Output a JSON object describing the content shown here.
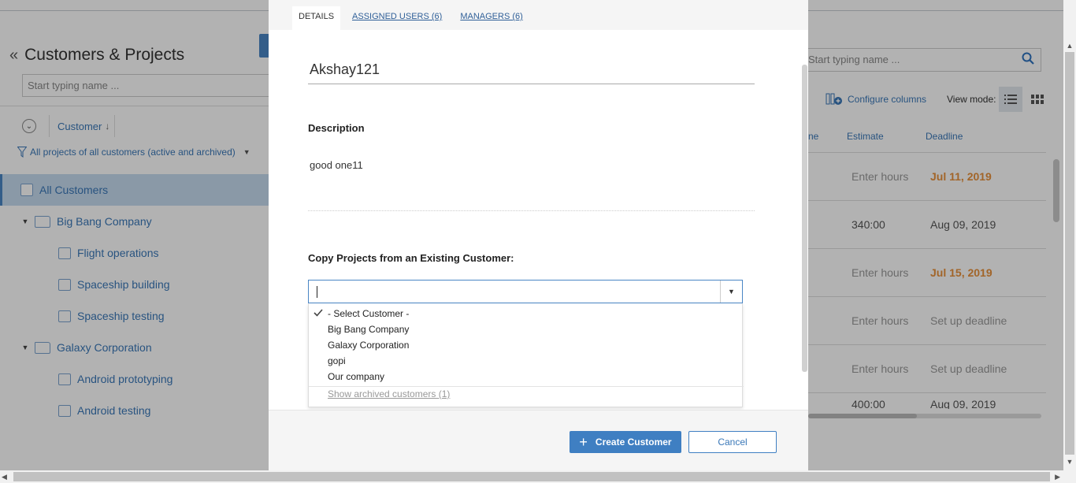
{
  "left": {
    "title": "Customers & Projects",
    "search_placeholder": "Start typing name ...",
    "sort_label": "Customer",
    "filter_label": "All projects of all customers (active and archived)",
    "tree": [
      {
        "label": "All Customers",
        "kind": "all",
        "selected": true
      },
      {
        "label": "Big Bang Company",
        "kind": "customer"
      },
      {
        "label": "Flight operations",
        "kind": "project"
      },
      {
        "label": "Spaceship building",
        "kind": "project"
      },
      {
        "label": "Spaceship testing",
        "kind": "project"
      },
      {
        "label": "Galaxy Corporation",
        "kind": "customer"
      },
      {
        "label": "Android prototyping",
        "kind": "project"
      },
      {
        "label": "Android testing",
        "kind": "project"
      }
    ]
  },
  "right": {
    "search_placeholder": "Start typing name ...",
    "configure_columns": "Configure columns",
    "view_mode_label": "View mode:",
    "columns": {
      "partial": "ne",
      "estimate": "Estimate",
      "deadline": "Deadline"
    },
    "rows": [
      {
        "estimate": "Enter hours",
        "deadline": "Jul 11, 2019"
      },
      {
        "estimate": "340:00",
        "deadline": "Aug 09, 2019"
      },
      {
        "estimate": "Enter hours",
        "deadline": "Jul 15, 2019"
      },
      {
        "estimate": "Enter hours",
        "deadline": "Set up deadline"
      },
      {
        "estimate": "Enter hours",
        "deadline": "Set up deadline"
      },
      {
        "estimate": "400:00",
        "deadline": "Aug 09, 2019"
      }
    ]
  },
  "modal": {
    "tabs": {
      "details": "DETAILS",
      "assigned_users": "ASSIGNED USERS (6)",
      "managers": "MANAGERS (6)"
    },
    "name_value": "Akshay121",
    "description_label": "Description",
    "description_value": "good one11",
    "copy_label": "Copy Projects from an Existing Customer:",
    "select_value": "",
    "options": [
      "- Select Customer -",
      "Big Bang Company",
      "Galaxy Corporation",
      "gopi",
      "Our company"
    ],
    "selected_option": "- Select Customer -",
    "show_archived": "Show archived customers (1)",
    "create_button": "Create Customer",
    "cancel_button": "Cancel"
  },
  "colors": {
    "accent": "#3f7fc2",
    "link": "#3a78b8",
    "overdue": "#e8913c",
    "overlay": "rgba(0,0,0,0.30)"
  }
}
